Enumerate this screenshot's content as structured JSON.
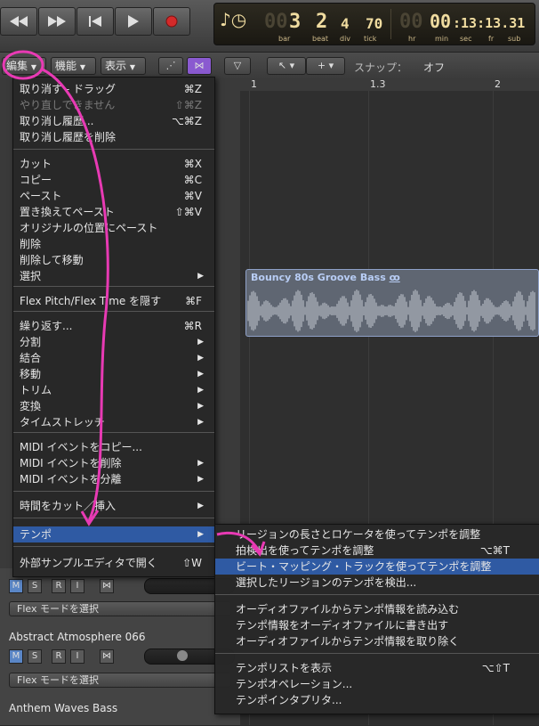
{
  "transport": {
    "position": {
      "bar": "3",
      "beat": "2",
      "div": "4",
      "tick": "70"
    },
    "position_labels": {
      "bar": "bar",
      "beat": "beat",
      "div": "div",
      "tick": "tick"
    },
    "time": {
      "hr": "00",
      "min": "00",
      "sec": "13",
      "fr": "13",
      "sub": "31",
      "display": "00:13:13.31"
    },
    "time_labels": {
      "hr": "hr",
      "min": "min",
      "sec": "sec",
      "fr": "fr",
      "sub": "sub"
    }
  },
  "toolbar": {
    "edit_menu": "編集",
    "function_menu": "機能",
    "view_menu": "表示",
    "snap_label": "スナップ：",
    "snap_value": "オフ"
  },
  "ruler": {
    "marks": [
      "1",
      "1.3",
      "2"
    ]
  },
  "region": {
    "title": "Bouncy 80s Groove Bass",
    "loop_symbol": "ꝏ"
  },
  "tracks": [
    {
      "name": "Abstract Atmosphere 066",
      "flex": "Flex モードを選択"
    },
    {
      "name": "Anthem Waves Bass",
      "flex": "Flex モードを選択"
    }
  ],
  "track_buttons": {
    "m": "M",
    "s": "S",
    "r": "R",
    "i": "I"
  },
  "flex_top": "Flex モードを選択",
  "edit_menu": {
    "items": [
      {
        "label": "取り消す - ドラッグ",
        "shortcut": "⌘Z"
      },
      {
        "label": "やり直しできません",
        "shortcut": "⇧⌘Z"
      },
      {
        "label": "取り消し履歴...",
        "shortcut": "⌥⌘Z"
      },
      {
        "label": "取り消し履歴を削除",
        "shortcut": ""
      },
      {
        "label": "カット",
        "shortcut": "⌘X"
      },
      {
        "label": "コピー",
        "shortcut": "⌘C"
      },
      {
        "label": "ペースト",
        "shortcut": "⌘V"
      },
      {
        "label": "置き換えてペースト",
        "shortcut": "⇧⌘V"
      },
      {
        "label": "オリジナルの位置にペースト",
        "shortcut": ""
      },
      {
        "label": "削除",
        "shortcut": ""
      },
      {
        "label": "削除して移動",
        "shortcut": ""
      },
      {
        "label": "選択",
        "shortcut": ""
      },
      {
        "label": "Flex Pitch/Flex Time を隠す",
        "shortcut": "⌘F"
      },
      {
        "label": "繰り返す...",
        "shortcut": "⌘R"
      },
      {
        "label": "分割",
        "shortcut": ""
      },
      {
        "label": "結合",
        "shortcut": ""
      },
      {
        "label": "移動",
        "shortcut": ""
      },
      {
        "label": "トリム",
        "shortcut": ""
      },
      {
        "label": "変換",
        "shortcut": ""
      },
      {
        "label": "タイムストレッチ",
        "shortcut": ""
      },
      {
        "label": "MIDI イベントをコピー...",
        "shortcut": ""
      },
      {
        "label": "MIDI イベントを削除",
        "shortcut": ""
      },
      {
        "label": "MIDI イベントを分離",
        "shortcut": ""
      },
      {
        "label": "時間をカット／挿入",
        "shortcut": ""
      },
      {
        "label": "テンポ",
        "shortcut": ""
      },
      {
        "label": "外部サンプルエディタで開く",
        "shortcut": "⇧W"
      }
    ]
  },
  "tempo_submenu": {
    "items": [
      {
        "label": "リージョンの長さとロケータを使ってテンポを調整",
        "shortcut": ""
      },
      {
        "label": "拍検出を使ってテンポを調整",
        "shortcut": "⌥⌘T"
      },
      {
        "label": "ビート・マッピング・トラックを使ってテンポを調整",
        "shortcut": ""
      },
      {
        "label": "選択したリージョンのテンポを検出...",
        "shortcut": ""
      },
      {
        "label": "オーディオファイルからテンポ情報を読み込む",
        "shortcut": ""
      },
      {
        "label": "テンポ情報をオーディオファイルに書き出す",
        "shortcut": ""
      },
      {
        "label": "オーディオファイルからテンポ情報を取り除く",
        "shortcut": ""
      },
      {
        "label": "テンポリストを表示",
        "shortcut": "⌥⇧T"
      },
      {
        "label": "テンポオペレーション...",
        "shortcut": ""
      },
      {
        "label": "テンポインタプリタ...",
        "shortcut": ""
      }
    ]
  },
  "colors": {
    "highlight": "#2f5aa3",
    "annotation": "#e83ab4",
    "lcd_text": "#f0dca0",
    "record": "#d42a2a"
  }
}
